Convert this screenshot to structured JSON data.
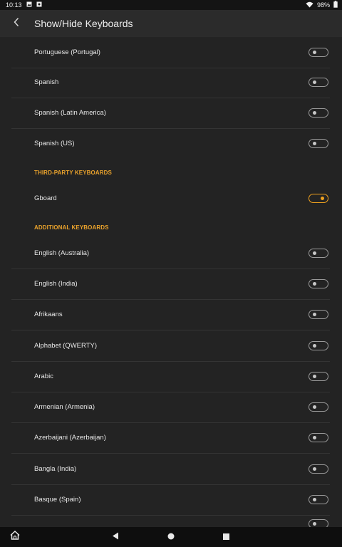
{
  "status_bar": {
    "time": "10:13",
    "icons": [
      "image-icon",
      "notification-icon"
    ],
    "wifi_icon": "wifi-icon",
    "battery_percent": "98%",
    "battery_icon": "battery-icon"
  },
  "header": {
    "back_icon": "chevron-left-icon",
    "title": "Show/Hide Keyboards"
  },
  "list": {
    "top_rows": [
      {
        "label": "Portuguese (Portugal)",
        "enabled": false
      },
      {
        "label": "Spanish",
        "enabled": false
      },
      {
        "label": "Spanish (Latin America)",
        "enabled": false
      },
      {
        "label": "Spanish (US)",
        "enabled": false
      }
    ],
    "third_party_header": "THIRD-PARTY KEYBOARDS",
    "third_party_rows": [
      {
        "label": "Gboard",
        "enabled": true
      }
    ],
    "additional_header": "ADDITIONAL KEYBOARDS",
    "additional_rows": [
      {
        "label": "English (Australia)",
        "enabled": false
      },
      {
        "label": "English (India)",
        "enabled": false
      },
      {
        "label": "Afrikaans",
        "enabled": false
      },
      {
        "label": "Alphabet (QWERTY)",
        "enabled": false
      },
      {
        "label": "Arabic",
        "enabled": false
      },
      {
        "label": "Armenian (Armenia)",
        "enabled": false
      },
      {
        "label": "Azerbaijani (Azerbaijan)",
        "enabled": false
      },
      {
        "label": "Bangla (India)",
        "enabled": false
      },
      {
        "label": "Basque (Spain)",
        "enabled": false
      }
    ]
  },
  "colors": {
    "accent": "#f0a21f",
    "background": "#232323",
    "app_bar": "#2b2b2b",
    "nav_bar": "#0e0e0e"
  },
  "nav_bar": {
    "home_icon": "home-icon",
    "back_icon": "back-triangle-icon",
    "recents_home_icon": "circle-icon",
    "overview_icon": "square-icon"
  }
}
